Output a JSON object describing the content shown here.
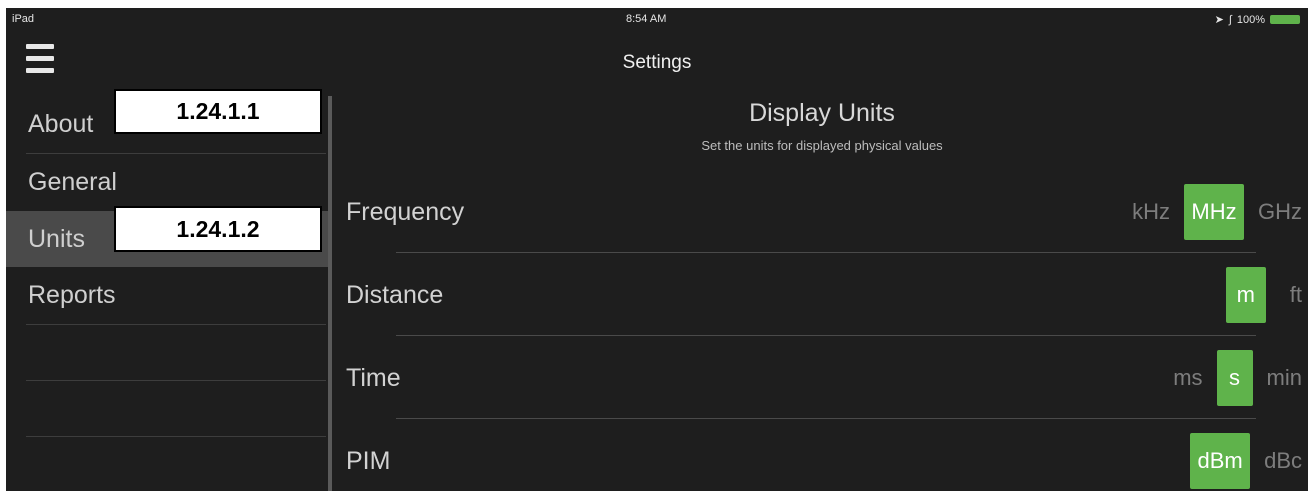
{
  "statusbar": {
    "device": "iPad",
    "time": "8:54 AM",
    "battery": "100%"
  },
  "header": {
    "title": "Settings"
  },
  "sidebar": {
    "items": [
      {
        "label": "About"
      },
      {
        "label": "General"
      },
      {
        "label": "Units"
      },
      {
        "label": "Reports"
      }
    ]
  },
  "callouts": {
    "about": "1.24.1.1",
    "units": "1.24.1.2"
  },
  "main": {
    "title": "Display Units",
    "subtitle": "Set the units for displayed physical values",
    "rows": [
      {
        "name": "Frequency",
        "options": [
          "kHz",
          "MHz",
          "GHz"
        ],
        "selected": "MHz"
      },
      {
        "name": "Distance",
        "options": [
          "m",
          "ft"
        ],
        "selected": "m"
      },
      {
        "name": "Time",
        "options": [
          "ms",
          "s",
          "min"
        ],
        "selected": "s"
      },
      {
        "name": "PIM",
        "options": [
          "dBm",
          "dBc"
        ],
        "selected": "dBm"
      }
    ]
  },
  "colors": {
    "accent": "#5fb34b",
    "background": "#1e1e1e",
    "selected_row": "#4a4a4a"
  }
}
